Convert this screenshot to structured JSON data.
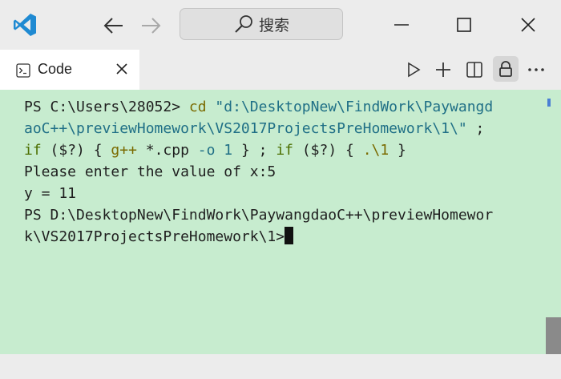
{
  "titlebar": {
    "search_label": "搜索",
    "logo_icon": "vscode-logo",
    "accent": "#1f8ad2"
  },
  "tab": {
    "label": "Code",
    "icon": "terminal-icon"
  },
  "terminal": {
    "background": "#c7eccf",
    "lines": {
      "l1_prompt": "PS C:\\Users\\28052> ",
      "l1_cmd": "cd",
      "l1_str": " \"d:\\DesktopNew\\FindWork\\Paywangd",
      "l2_str": "aoC++\\previewHomework\\VS2017ProjectsPreHomework\\1\\\"",
      "l2_rest": " ;",
      "l3_if1": "if",
      "l3_a": " ($?) { ",
      "l3_gpp": "g++",
      "l3_b": " *.cpp ",
      "l3_o": "-o 1",
      "l3_c": " } ; ",
      "l3_if2": "if",
      "l3_d": " ($?) { ",
      "l3_run": ".\\1",
      "l3_e": " }",
      "l4": "Please enter the value of x:5",
      "l5": "y = 11",
      "l6": "PS D:\\DesktopNew\\FindWork\\PaywangdaoC++\\previewHomewor",
      "l7": "k\\VS2017ProjectsPreHomework\\1>"
    }
  }
}
